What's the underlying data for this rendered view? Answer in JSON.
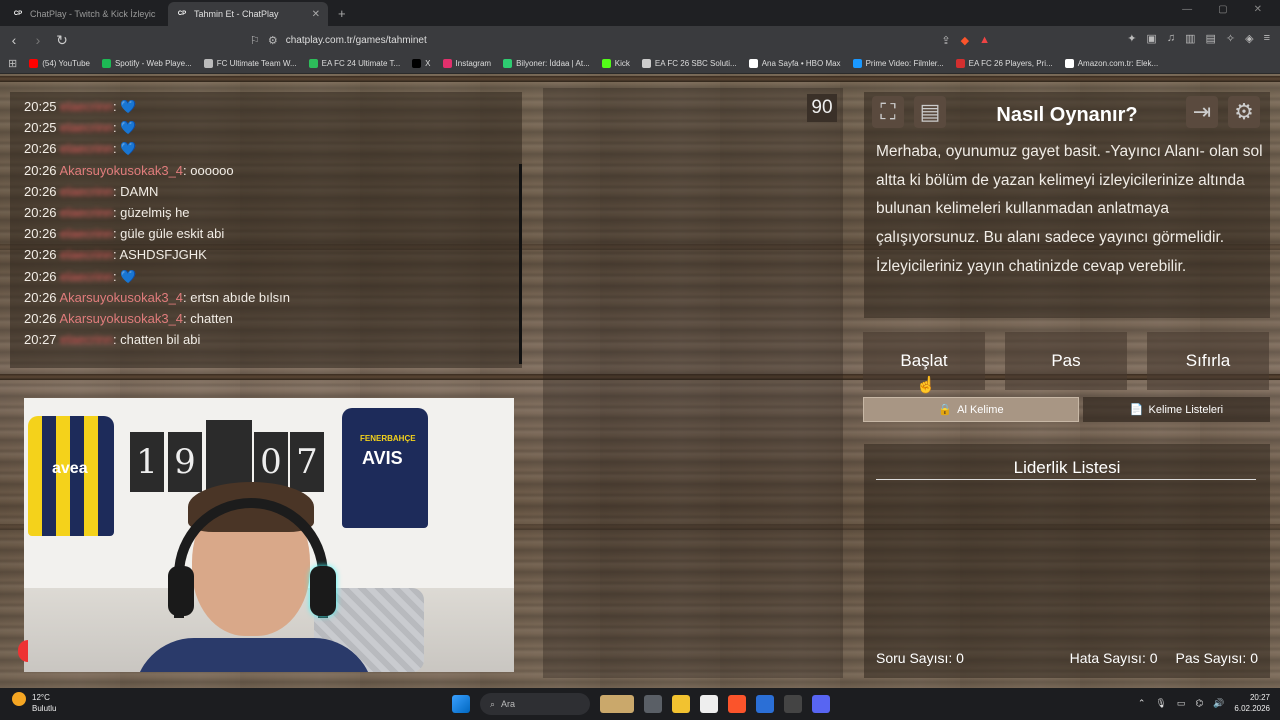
{
  "browser": {
    "tabs": [
      {
        "title": "ChatPlay - Twitch & Kick İzleyici Etkile",
        "favicon": "CP"
      },
      {
        "title": "Tahmin Et - ChatPlay",
        "favicon": "CP"
      }
    ],
    "url": "chatplay.com.tr/games/tahminet",
    "bookmarks": [
      {
        "label": "(54) YouTube",
        "color": "#ff0000"
      },
      {
        "label": "Spotify - Web Playe...",
        "color": "#1db954"
      },
      {
        "label": "FC Ultimate Team W...",
        "color": "#bbbbbb"
      },
      {
        "label": "EA FC 24 Ultimate T...",
        "color": "#2dbd5a"
      },
      {
        "label": "X",
        "color": "#000000"
      },
      {
        "label": "Instagram",
        "color": "#e1306c"
      },
      {
        "label": "Bilyoner: İddaa | At...",
        "color": "#2ecc71"
      },
      {
        "label": "Kick",
        "color": "#53fc18"
      },
      {
        "label": "EA FC 26 SBC Soluti...",
        "color": "#cccccc"
      },
      {
        "label": "Ana Sayfa • HBO Max",
        "color": "#ffffff"
      },
      {
        "label": "Prime Video: Filmler...",
        "color": "#1a98ff"
      },
      {
        "label": "EA FC 26 Players, Pri...",
        "color": "#d32f2f"
      },
      {
        "label": "Amazon.com.tr: Elek...",
        "color": "#ffffff"
      }
    ]
  },
  "chat": {
    "messages": [
      {
        "time": "20:25",
        "user": "elaecrinn",
        "blur": true,
        "text": "💙"
      },
      {
        "time": "20:25",
        "user": "elaecrinn",
        "blur": true,
        "text": "💙"
      },
      {
        "time": "20:26",
        "user": "elaecrinn",
        "blur": true,
        "text": "💙"
      },
      {
        "time": "20:26",
        "user": "Akarsuyokusokak3_4",
        "blur": false,
        "text": "oooooo"
      },
      {
        "time": "20:26",
        "user": "elaecrinn",
        "blur": true,
        "text": "DAMN"
      },
      {
        "time": "20:26",
        "user": "elaecrinn",
        "blur": true,
        "text": "güzelmiş he"
      },
      {
        "time": "20:26",
        "user": "elaecrinn",
        "blur": true,
        "text": "güle güle eskit abi"
      },
      {
        "time": "20:26",
        "user": "elaecrinn",
        "blur": true,
        "text": "ASHDSFJGHK"
      },
      {
        "time": "20:26",
        "user": "elaecrinn",
        "blur": true,
        "text": "💙"
      },
      {
        "time": "20:26",
        "user": "Akarsuyokusokak3_4",
        "blur": false,
        "text": "ertsn abıde bılsın"
      },
      {
        "time": "20:26",
        "user": "Akarsuyokusokak3_4",
        "blur": false,
        "text": "chatten"
      },
      {
        "time": "20:27",
        "user": "elaecrinn",
        "blur": true,
        "text": "chatten bil abi"
      }
    ]
  },
  "webcam": {
    "jersey_text": "AVIS",
    "jersey_brand": "FENERBAHÇE",
    "numbers": [
      "1",
      "9",
      "0",
      "7"
    ],
    "left_jersey": "avea"
  },
  "game": {
    "timer": "90"
  },
  "howto": {
    "title": "Nasıl Oynanır?",
    "text": "Merhaba, oyunumuz gayet basit. -Yayıncı Alanı- olan sol altta ki bölüm de yazan kelimeyi izleyicilerinize altında bulunan kelimeleri kullanmadan anlatmaya çalışıyorsunuz. Bu alanı sadece yayıncı görmelidir. İzleyicileriniz yayın chatinizde cevap verebilir."
  },
  "controls": {
    "start": "Başlat",
    "pass": "Pas",
    "reset": "Sıfırla",
    "get_word": "Al Kelime",
    "word_lists": "Kelime Listeleri"
  },
  "leaderboard": {
    "title": "Liderlik Listesi",
    "questions": "Soru Sayısı: 0",
    "errors": "Hata Sayısı: 0",
    "passes": "Pas Sayısı: 0"
  },
  "taskbar": {
    "temp": "12°C",
    "weather": "Bulutlu",
    "search": "Ara",
    "time": "20:27",
    "date": "6.02.2026"
  }
}
